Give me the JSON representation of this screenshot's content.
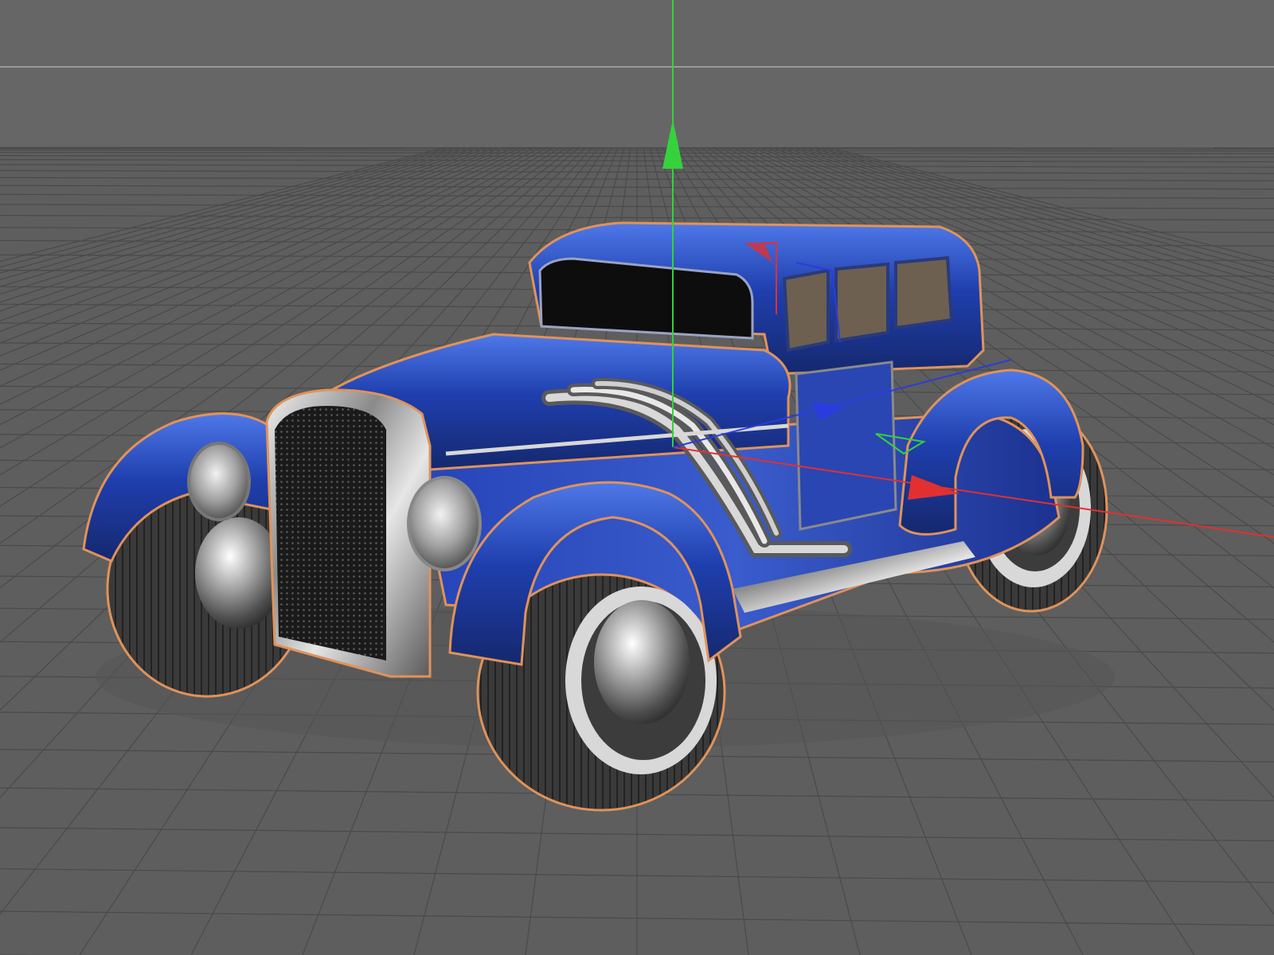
{
  "viewport": {
    "view": "perspective",
    "background": "#5e5e5e",
    "grid_color": "#4a4a4a",
    "horizon_color": "#9a9a9a",
    "grid": true
  },
  "selection": {
    "object": "vintage-car",
    "highlight_color": "#e0935a"
  },
  "car": {
    "paint_color": "#1f3fae",
    "paint_highlight": "#4f78e8",
    "chrome_color": "#c9c9c9",
    "tire_color": "#3a3a3a",
    "whitewall_color": "#d8d8d8",
    "glass_color": "#0d0d0d"
  },
  "gizmo": {
    "mode": "move",
    "x_axis_color": "#e23030",
    "y_axis_color": "#35d23c",
    "z_axis_color": "#2a3be0"
  }
}
